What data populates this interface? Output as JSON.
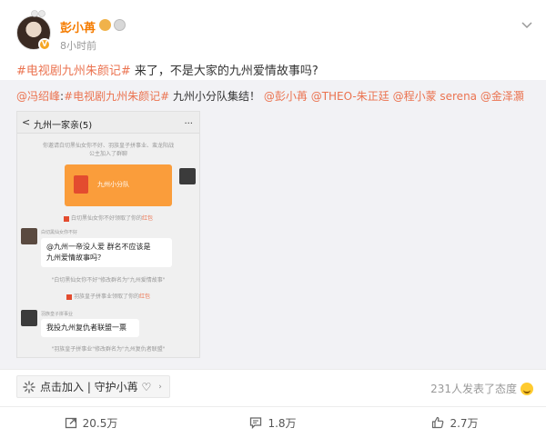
{
  "post": {
    "username": "彭小苒",
    "time": "8小时前",
    "verified_mark": "V",
    "topic": "#电视剧九州朱颜记#",
    "text_rest": " 来了，不是大家的九州爱情故事吗?"
  },
  "repost": {
    "mention_1": "@冯绍峰",
    "sep": ":",
    "topic": "#电视剧九州朱颜记#",
    "text_mid": " 九州小分队集结！",
    "mention_2": "@彭小苒",
    "mention_3": "@THEO-朱正廷",
    "mention_4": "@程小蒙 serena",
    "mention_5": "@金泽灝"
  },
  "chat": {
    "back": "<",
    "title": "九州一家亲(5)",
    "more": "...",
    "sys_1": "你邀请白切黑仙女你不好、羽族皇子拼事业、蛮龙阳战",
    "sys_2": "公主加入了群聊",
    "redpack_label": "九州小分队",
    "sys_3_pre": "白切黑仙女你不好领取了你的",
    "sys_3_link": "红包",
    "sender_1": "白切黑仙女你不好",
    "msg_1_line1": "@九州一帝没人爱  群名不应该是",
    "msg_1_line2": "九州爱情故事吗？",
    "sys_4": "\"白切黑仙女你不好\"修改群名为\"九州爱情故事\"",
    "sys_5_pre": "羽族皇子拼事业领取了你的",
    "sys_5_link": "红包",
    "sender_2": "羽族皇子拼事业",
    "msg_2": "我投九州复仇者联盟一票",
    "sys_6": "\"羽族皇子拼事业\"修改群名为\"九州复仇者联盟\""
  },
  "footer": {
    "join_label": "点击加入 | 守护小苒 ♡",
    "join_arrow": "›",
    "attitude": "231人发表了态度",
    "repost_count": "20.5万",
    "comment_count": "1.8万",
    "like_count": "2.7万"
  },
  "colors": {
    "accent": "#eb7350",
    "username": "#f57c00",
    "repost_bg": "#f2f2f5"
  },
  "icons": [
    "more-chevron-icon",
    "share-icon",
    "comment-icon",
    "like-icon",
    "join-icon",
    "smiley-icon"
  ]
}
